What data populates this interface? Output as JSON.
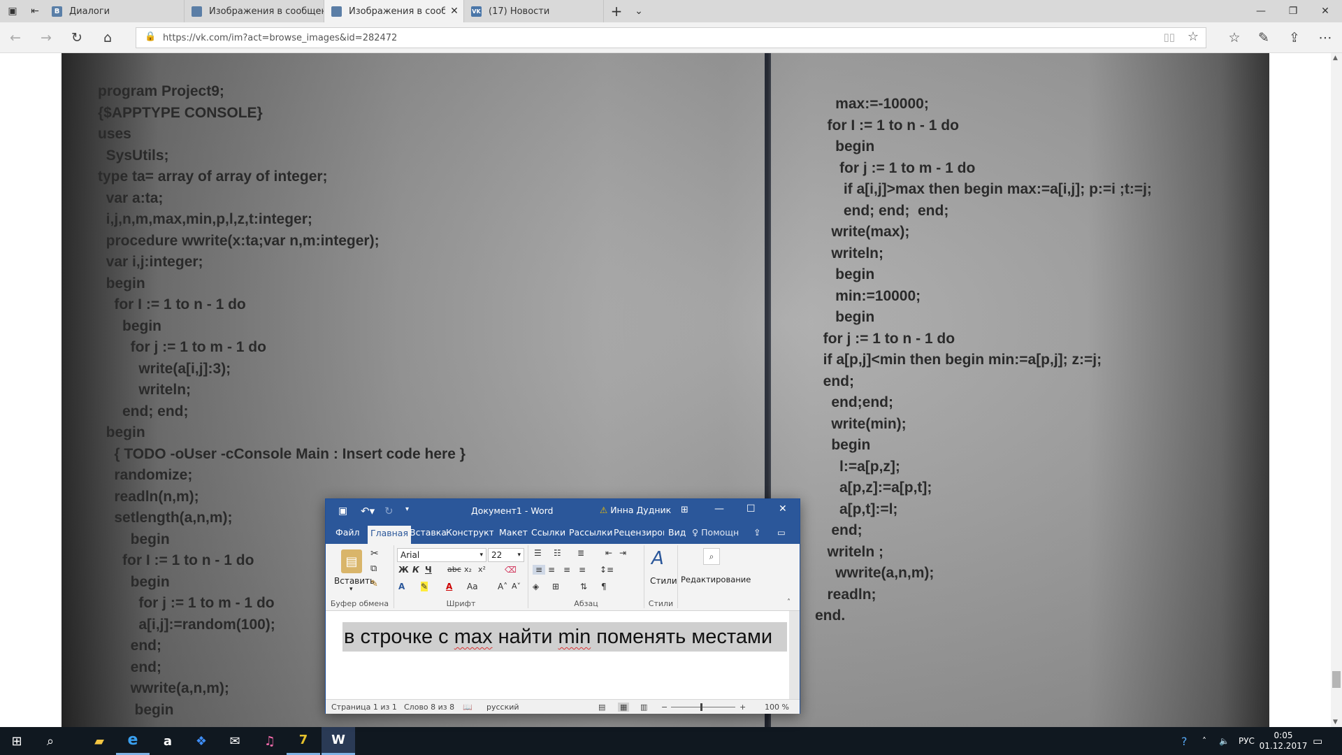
{
  "browser": {
    "tabs": [
      {
        "label": "Диалоги",
        "favicon": "В"
      },
      {
        "label": "Изображения в сообщени",
        "favicon": ""
      },
      {
        "label": "Изображения в сообщ",
        "favicon": "",
        "close": "✕"
      },
      {
        "label": "(17) Новости",
        "favicon": "VK"
      }
    ],
    "new_tab": "+",
    "url": "https://vk.com/im?act=browse_images&id=282472"
  },
  "photo": {
    "left_code": [
      "program Project9;",
      "{$APPTYPE CONSOLE}",
      "uses",
      "  SysUtils;",
      "type ta= array of array of integer;",
      "  var a:ta;",
      "  i,j,n,m,max,min,p,l,z,t:integer;",
      "  procedure wwrite(x:ta;var n,m:integer);",
      "  var i,j:integer;",
      "  begin",
      "    for I := 1 to n - 1 do",
      "      begin",
      "        for j := 1 to m - 1 do",
      "          write(a[i,j]:3);",
      "          writeln;",
      "      end; end;",
      "  begin",
      "    { TODO -oUser -cConsole Main : Insert code here }",
      "    randomize;",
      "    readln(n,m);",
      "    setlength(a,n,m);",
      "        begin",
      "      for I := 1 to n - 1 do",
      "        begin",
      "          for j := 1 to m - 1 do",
      "          a[i,j]:=random(100);",
      "        end;",
      "        end;",
      "        wwrite(a,n,m);",
      "         begin"
    ],
    "right_code": [
      "     max:=-10000;",
      "   for I := 1 to n - 1 do",
      "     begin",
      "      for j := 1 to m - 1 do",
      "       if a[i,j]>max then begin max:=a[i,j]; p:=i ;t:=j;",
      "       end; end;  end;",
      "    write(max);",
      "    writeln;",
      "     begin",
      "     min:=10000;",
      "     begin",
      "  for j := 1 to n - 1 do",
      "  if a[p,j]<min then begin min:=a[p,j]; z:=j;",
      "  end;",
      "    end;end;",
      "    write(min);",
      "    begin",
      "      l:=a[p,z];",
      "      a[p,z]:=a[p,t];",
      "      a[p,t]:=l;",
      "    end;",
      "   writeln ;",
      "     wwrite(a,n,m);",
      "   readln;",
      "end."
    ]
  },
  "word": {
    "title": "Документ1  -  Word",
    "user": "Инна Дудник",
    "tabs": [
      "Файл",
      "Главная",
      "Вставка",
      "Конструктор",
      "Макет",
      "Ссылки",
      "Рассылки",
      "Рецензирова",
      "Вид"
    ],
    "tell_me": "Помощн",
    "font_name": "Arial",
    "font_size": "22",
    "paste_label": "Вставить",
    "styles_label": "Стили",
    "editing_label": "Редактирование",
    "groups": [
      "Буфер обмена",
      "Шрифт",
      "Абзац",
      "Стили"
    ],
    "doc_text_parts": [
      "в строчке с ",
      "max",
      " найти ",
      "min",
      " поменять местами"
    ],
    "status": {
      "page": "Страница 1 из 1",
      "words": "Слово 8 из 8",
      "language": "русский",
      "zoom": "100 %"
    }
  },
  "tray": {
    "lang": "РУС",
    "time": "0:05",
    "date": "01.12.2017"
  },
  "colors": {
    "word_blue": "#2b579a",
    "taskbar": "#101820"
  }
}
